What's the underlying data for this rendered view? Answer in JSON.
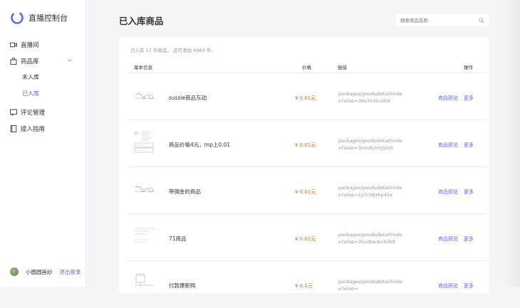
{
  "brand": {
    "title": "直播控制台",
    "accent": "#5b6bf5"
  },
  "sidebar": {
    "items": [
      {
        "label": "直播间",
        "icon": "video-camera-icon"
      },
      {
        "label": "商品库",
        "icon": "shopping-bag-icon"
      },
      {
        "label": "评论管理",
        "icon": "comment-icon"
      },
      {
        "label": "接入指南",
        "icon": "book-icon"
      }
    ],
    "sub_items": [
      {
        "label": "未入库",
        "active": false
      },
      {
        "label": "已入库",
        "active": true
      }
    ],
    "user": {
      "name": "小圆圆画纱",
      "logout": "退出登录"
    }
  },
  "header": {
    "title": "已入库商品"
  },
  "search": {
    "placeholder": "搜索商品名称"
  },
  "summary": "已入库 17 件商品， 还可添加 4983 件。",
  "table": {
    "headers": [
      "基本信息",
      "价格",
      "链接",
      "操作"
    ],
    "rows": [
      {
        "name": "sussie商品东动",
        "price": "¥ 0.01元",
        "link": "packages/goods/detail/index?alias=36a7irxknsiz9",
        "op_preview": "商品预览",
        "op_more": "更多",
        "thumb": "sketch-drawing"
      },
      {
        "name": "商品价格4元，mp上0.01",
        "price": "¥ 0.01元",
        "link": "packages/goods/detail/index?alias=3nmdyzmj5zxh",
        "op_preview": "商品预览",
        "op_more": "更多",
        "thumb": "document-scan"
      },
      {
        "name": "带佣金的商品",
        "price": "¥ 0.01元",
        "link": "packages/goods/detail/index?alias=1y7nldjxhp45x",
        "op_preview": "商品预览",
        "op_more": "更多",
        "thumb": "sketch-drawing"
      },
      {
        "name": "71商品",
        "price": "¥ 0.02元",
        "link": "packages/goods/detail/index?alias=35vdtwnkc67b9",
        "op_preview": "商品预览",
        "op_more": "更多",
        "thumb": "text-scan"
      },
      {
        "name": "付款建新购",
        "price": "¥ 0.1元",
        "link": "packages/goods/detail/index?alias=",
        "op_preview": "商品预览",
        "op_more": "更多",
        "thumb": "line-drawing"
      }
    ]
  }
}
